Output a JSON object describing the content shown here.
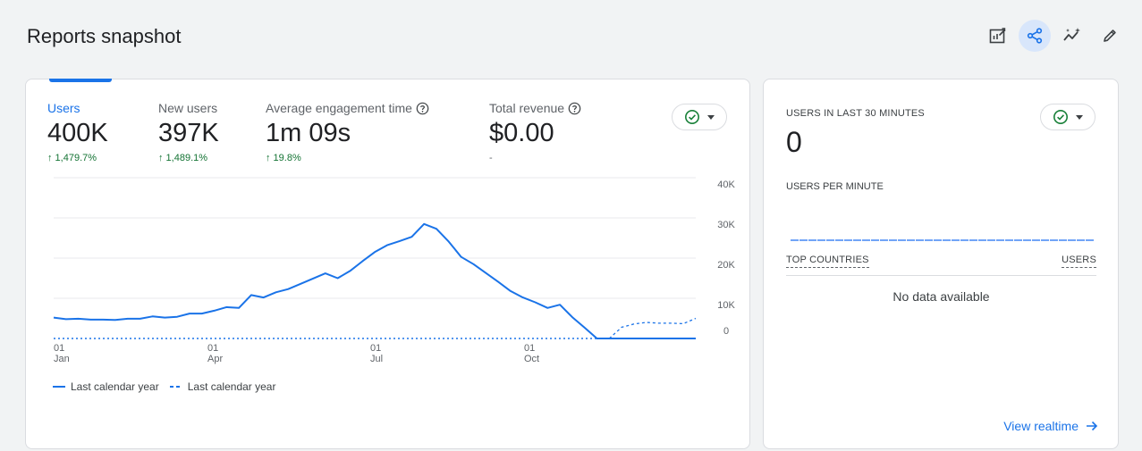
{
  "page": {
    "title": "Reports snapshot"
  },
  "toolbar": {
    "buttons": [
      {
        "icon": "customize-report-icon"
      },
      {
        "icon": "share-icon",
        "active": true
      },
      {
        "icon": "insights-icon"
      },
      {
        "icon": "edit-icon"
      }
    ]
  },
  "metrics": [
    {
      "label": "Users",
      "value": "400K",
      "change": "↑ 1,479.7%",
      "active": true
    },
    {
      "label": "New users",
      "value": "397K",
      "change": "↑ 1,489.1%"
    },
    {
      "label": "Average engagement time",
      "value": "1m 09s",
      "change": "↑ 19.8%",
      "help": true
    },
    {
      "label": "Total revenue",
      "value": "$0.00",
      "change": "-",
      "help": true
    }
  ],
  "chart_data": {
    "type": "line",
    "x_ticks": [
      {
        "day": "01",
        "month": "Jan"
      },
      {
        "day": "01",
        "month": "Apr"
      },
      {
        "day": "01",
        "month": "Jul"
      },
      {
        "day": "01",
        "month": "Oct"
      }
    ],
    "y_ticks": [
      "40K",
      "30K",
      "20K",
      "10K",
      "0"
    ],
    "ylim": [
      0,
      40000
    ],
    "series": [
      {
        "name": "Last calendar year",
        "style": "solid",
        "values": [
          5200,
          4800,
          4900,
          4700,
          4700,
          4600,
          4900,
          4900,
          5500,
          5200,
          5400,
          6200,
          6200,
          6900,
          7800,
          7600,
          10800,
          10200,
          11500,
          12300,
          13600,
          14900,
          16200,
          15000,
          16800,
          19200,
          21500,
          23200,
          24200,
          25300,
          28500,
          27300,
          24100,
          20300,
          18500,
          16300,
          14100,
          11800,
          10200,
          9000,
          7600,
          8400,
          5300,
          2700,
          0,
          0,
          0,
          0,
          0,
          0,
          0,
          0,
          0
        ]
      },
      {
        "name": "Last calendar year",
        "style": "dashed",
        "values": [
          0,
          0,
          0,
          0,
          0,
          0,
          0,
          0,
          0,
          0,
          0,
          0,
          0,
          0,
          0,
          0,
          0,
          0,
          0,
          0,
          0,
          0,
          0,
          0,
          0,
          0,
          0,
          0,
          0,
          0,
          0,
          0,
          0,
          0,
          0,
          0,
          0,
          0,
          0,
          0,
          0,
          0,
          0,
          0,
          0,
          0,
          2800,
          3600,
          4000,
          3800,
          3800,
          3700,
          5000
        ]
      }
    ],
    "colors": {
      "line": "#1a73e8",
      "grid": "#e8eaed"
    }
  },
  "legend": {
    "solid_label": "Last calendar year",
    "dashed_label": "Last calendar year"
  },
  "realtime": {
    "title": "USERS IN LAST 30 MINUTES",
    "count": "0",
    "per_minute_label": "USERS PER MINUTE",
    "table_col_1": "TOP COUNTRIES",
    "table_col_2": "USERS",
    "empty_text": "No data available",
    "link_label": "View realtime"
  },
  "colors": {
    "accent": "#1a73e8",
    "positive": "#137333",
    "check": "#188038"
  }
}
